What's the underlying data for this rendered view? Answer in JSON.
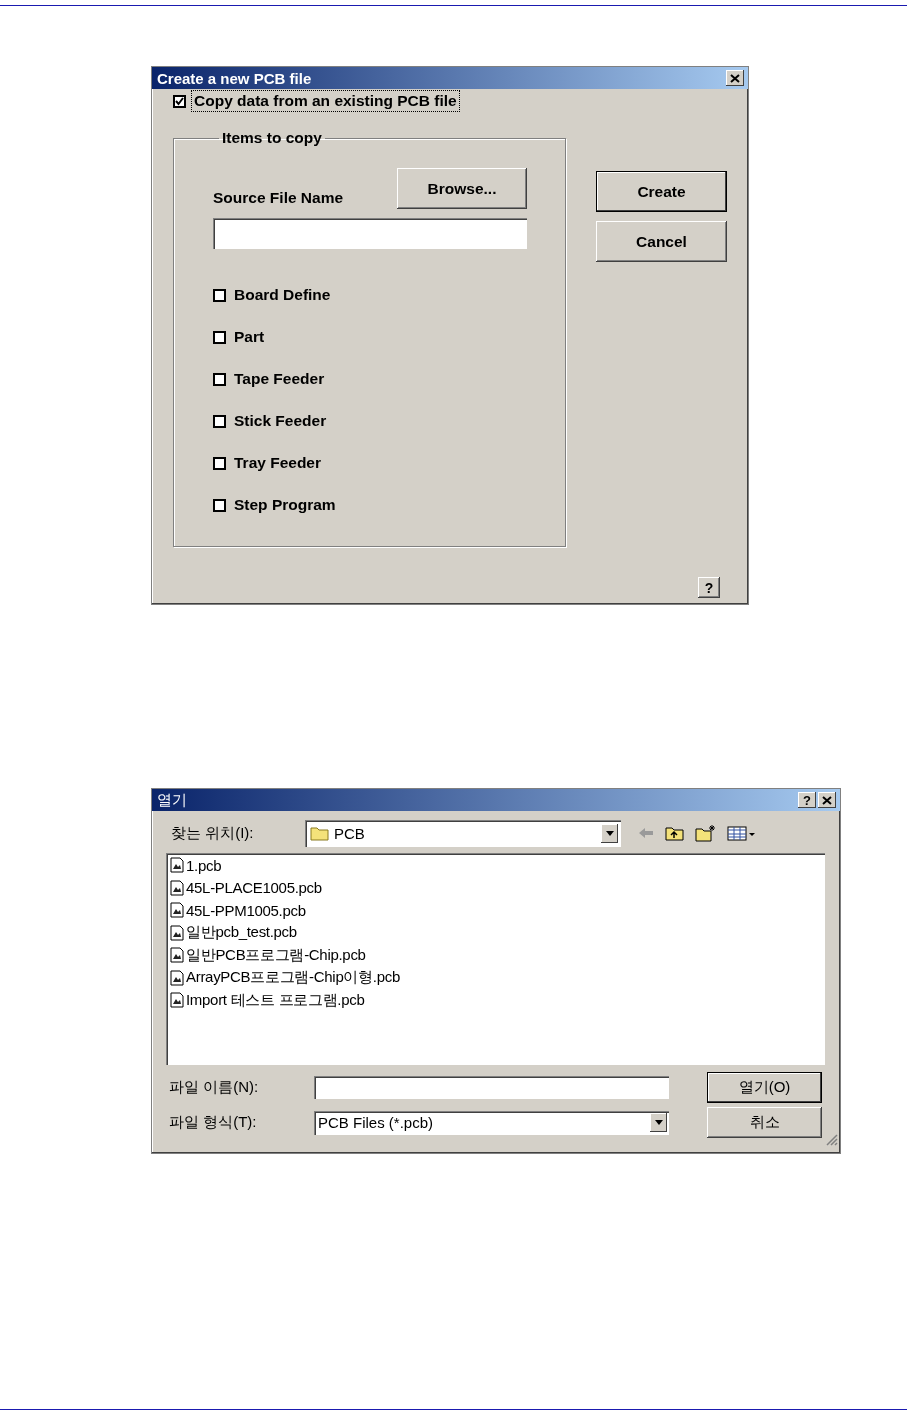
{
  "create_dialog": {
    "title": "Create a new PCB file",
    "copy_existing": {
      "label": "Copy data from an existing PCB file",
      "checked": true,
      "focused": true
    },
    "group_title": "Items to copy",
    "source_label": "Source File Name",
    "browse_button": "Browse...",
    "items": [
      {
        "label": "Board Define",
        "checked": false
      },
      {
        "label": "Part",
        "checked": false
      },
      {
        "label": "Tape Feeder",
        "checked": false
      },
      {
        "label": "Stick Feeder",
        "checked": false
      },
      {
        "label": "Tray Feeder",
        "checked": false
      },
      {
        "label": "Step Program",
        "checked": false
      }
    ],
    "buttons": [
      "Create",
      "Cancel"
    ],
    "help_button": "?"
  },
  "open_dialog": {
    "title": "열기",
    "help_button": "?",
    "look_in_label": "찾는 위치(I):",
    "look_in_value": "PCB",
    "files": [
      "1.pcb",
      "45L-PLACE1005.pcb",
      "45L-PPM1005.pcb",
      "일반pcb_test.pcb",
      "일반PCB프로그램-Chip.pcb",
      "ArrayPCB프로그램-Chip이형.pcb",
      "Import 테스트 프로그램.pcb"
    ],
    "file_name_label": "파일 이름(N):",
    "file_type_label": "파일 형식(T):",
    "file_type_value": "PCB Files (*.pcb)",
    "buttons": [
      "열기(O)",
      "취소"
    ]
  }
}
